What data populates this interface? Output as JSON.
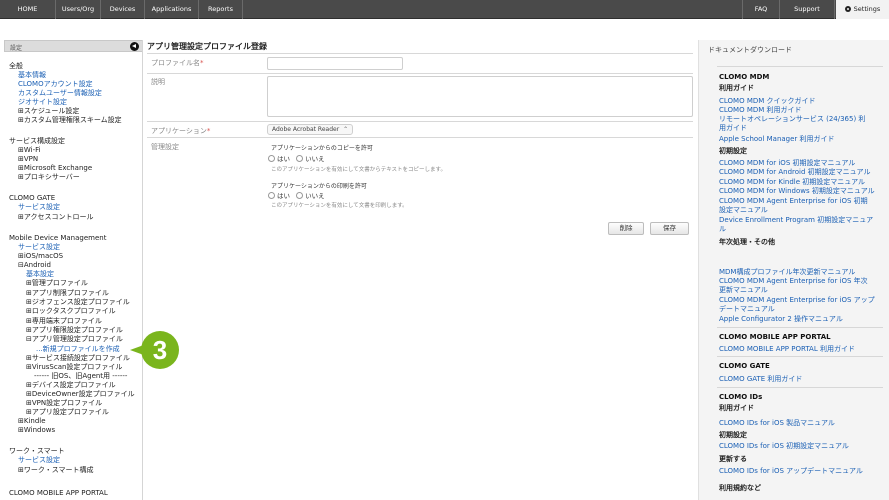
{
  "nav": {
    "left": [
      "HOME",
      "Users/Org",
      "Devices",
      "Applications",
      "Reports"
    ],
    "right": [
      "FAQ",
      "Support",
      "Settings"
    ]
  },
  "sidebar": {
    "header": "設定",
    "collapse_icon": "chevron-left-icon",
    "items": [
      {
        "t": "全般",
        "k": "h"
      },
      {
        "t": "基本情報",
        "k": "lk"
      },
      {
        "t": "CLOMOアカウント設定",
        "k": "lk"
      },
      {
        "t": "カスタムユーザー情報設定",
        "k": "lk"
      },
      {
        "t": "ジオサイト設定",
        "k": "lk"
      },
      {
        "t": "⊞スケジュール設定",
        "k": "tx"
      },
      {
        "t": "⊞カスタム管理権限スキーム設定",
        "k": "tx"
      },
      {
        "t": "サービス構成設定",
        "k": "h"
      },
      {
        "t": "⊞Wi-Fi",
        "k": "tx"
      },
      {
        "t": "⊞VPN",
        "k": "tx"
      },
      {
        "t": "⊞Microsoft Exchange",
        "k": "tx"
      },
      {
        "t": "⊞プロキシサーバー",
        "k": "tx"
      },
      {
        "t": "CLOMO GATE",
        "k": "h"
      },
      {
        "t": "サービス設定",
        "k": "lk"
      },
      {
        "t": "⊞アクセスコントロール",
        "k": "tx"
      },
      {
        "t": "Mobile Device Management",
        "k": "h"
      },
      {
        "t": "サービス設定",
        "k": "lk"
      },
      {
        "t": "⊞iOS/macOS",
        "k": "tx"
      },
      {
        "t": "⊟Android",
        "k": "tx"
      },
      {
        "t": "基本設定",
        "k": "lk"
      },
      {
        "t": "⊞管理プロファイル",
        "k": "tx"
      },
      {
        "t": "⊞アプリ制限プロファイル",
        "k": "tx"
      },
      {
        "t": "⊞ジオフェンス設定プロファイル",
        "k": "tx"
      },
      {
        "t": "⊞ロックタスクプロファイル",
        "k": "tx"
      },
      {
        "t": "⊞専用端末プロファイル",
        "k": "tx"
      },
      {
        "t": "⊞アプリ権限設定プロファイル",
        "k": "tx"
      },
      {
        "t": "⊟アプリ管理設定プロファイル",
        "k": "tx"
      },
      {
        "t": "...新規プロファイルを作成",
        "k": "cur"
      },
      {
        "t": "⊞サービス接続設定プロファイル",
        "k": "tx"
      },
      {
        "t": "⊞VirusScan設定プロファイル",
        "k": "tx"
      },
      {
        "t": "------ 旧OS、旧Agent用 ------",
        "k": "tx"
      },
      {
        "t": "⊞デバイス設定プロファイル",
        "k": "tx"
      },
      {
        "t": "⊞DeviceOwner設定プロファイル",
        "k": "tx"
      },
      {
        "t": "⊞VPN設定プロファイル",
        "k": "tx"
      },
      {
        "t": "⊞アプリ設定プロファイル",
        "k": "tx"
      },
      {
        "t": "⊞Kindle",
        "k": "tx"
      },
      {
        "t": "⊞Windows",
        "k": "tx"
      },
      {
        "t": "ワーク・スマート",
        "k": "h"
      },
      {
        "t": "サービス設定",
        "k": "lk"
      },
      {
        "t": "⊞ワーク・スマート構成",
        "k": "tx"
      },
      {
        "t": "CLOMO MOBILE APP PORTAL",
        "k": "h"
      }
    ]
  },
  "step_badge": "3",
  "form": {
    "title": "アプリ管理設定プロファイル登録",
    "profile_name_label": "プロファイル名",
    "profile_name_value": "",
    "description_label": "説明",
    "description_value": "",
    "required_mark": "*",
    "application_label": "アプリケーション",
    "application_value": "Adobe Acrobat Reader",
    "management_label": "管理設定",
    "copy_label": "アプリケーションからのコピーを許可",
    "copy_hint": "このアプリケーションを有効にして文書からテキストをコピーします。",
    "print_label": "アプリケーションからの印刷を許可",
    "print_hint": "このアプリケーションを有効にして文書を印刷します。",
    "yes": "はい",
    "no": "いいえ",
    "delete_button": "削除",
    "save_button": "保存"
  },
  "docs": {
    "title": "ドキュメントダウンロード",
    "items": [
      {
        "t": "CLOMO MDM",
        "k": "sec"
      },
      {
        "t": "利用ガイド",
        "k": "sub"
      },
      {
        "t": "CLOMO MDM クイックガイド",
        "k": "lk"
      },
      {
        "t": "CLOMO MDM 利用ガイド",
        "k": "lk"
      },
      {
        "t": "リモートオペレーションサービス (24/365) 利",
        "k": "lk"
      },
      {
        "t": "用ガイド",
        "k": "lk"
      },
      {
        "t": "Apple School Manager 利用ガイド",
        "k": "lk"
      },
      {
        "t": "初期設定",
        "k": "sub"
      },
      {
        "t": "CLOMO MDM for iOS 初期設定マニュアル",
        "k": "lk"
      },
      {
        "t": "CLOMO MDM for Android 初期設定マニュアル",
        "k": "lk"
      },
      {
        "t": "CLOMO MDM for Kindle 初期設定マニュアル",
        "k": "lk"
      },
      {
        "t": "CLOMO MDM for Windows 初期設定マニュアル",
        "k": "lk"
      },
      {
        "t": "CLOMO MDM Agent Enterprise for iOS 初期",
        "k": "lk"
      },
      {
        "t": "設定マニュアル",
        "k": "lk"
      },
      {
        "t": "Device Enrollment Program 初期設定マニュア",
        "k": "lk"
      },
      {
        "t": "ル",
        "k": "lk"
      },
      {
        "t": "年次処理・その他",
        "k": "sub"
      },
      {
        "t": "MDM構成プロファイル年次更新マニュアル",
        "k": "lk"
      },
      {
        "t": "CLOMO MDM Agent Enterprise for iOS 年次",
        "k": "lk"
      },
      {
        "t": "更新マニュアル",
        "k": "lk"
      },
      {
        "t": "CLOMO MDM Agent Enterprise for iOS アップ",
        "k": "lk"
      },
      {
        "t": "デートマニュアル",
        "k": "lk"
      },
      {
        "t": "Apple Configurator 2 操作マニュアル",
        "k": "lk"
      },
      {
        "t": "CLOMO MOBILE APP PORTAL",
        "k": "sec"
      },
      {
        "t": "CLOMO MOBILE APP PORTAL 利用ガイド",
        "k": "lk"
      },
      {
        "t": "CLOMO GATE",
        "k": "sec"
      },
      {
        "t": "CLOMO GATE 利用ガイド",
        "k": "lk"
      },
      {
        "t": "CLOMO IDs",
        "k": "sec"
      },
      {
        "t": "利用ガイド",
        "k": "sub"
      },
      {
        "t": "CLOMO IDs for iOS 製品マニュアル",
        "k": "lk"
      },
      {
        "t": "初期設定",
        "k": "sub"
      },
      {
        "t": "CLOMO IDs for iOS 初期設定マニュアル",
        "k": "lk"
      },
      {
        "t": "更新する",
        "k": "sub"
      },
      {
        "t": "CLOMO IDs for iOS アップデートマニュアル",
        "k": "lk"
      },
      {
        "t": "利用規約など",
        "k": "sub"
      }
    ]
  }
}
